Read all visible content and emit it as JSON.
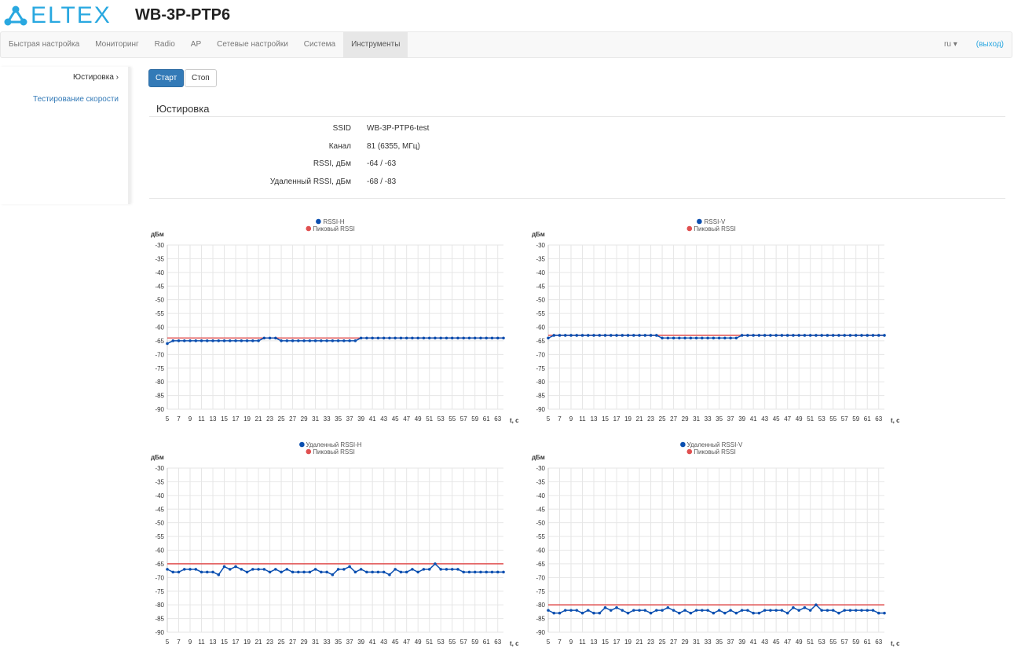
{
  "header": {
    "logo": "ELTEX",
    "device_title": "WB-3P-PTP6"
  },
  "nav": {
    "items": [
      "Быстрая настройка",
      "Мониторинг",
      "Radio",
      "AP",
      "Сетевые настройки",
      "Система",
      "Инструменты"
    ],
    "active": 6,
    "lang": "ru",
    "logout": "(выход)"
  },
  "sidebar": {
    "items": [
      {
        "label": "Юстировка ›"
      },
      {
        "label": "Тестирование скорости"
      }
    ]
  },
  "buttons": {
    "start": "Старт",
    "stop": "Стоп"
  },
  "section": {
    "title": "Юстировка",
    "rows": [
      {
        "k": "SSID",
        "v": "WB-3P-PTP6-test"
      },
      {
        "k": "Канал",
        "v": "81 (6355, МГц)"
      },
      {
        "k": "RSSI, дБм",
        "v": "-64 / -63"
      },
      {
        "k": "Удаленный RSSI, дБм",
        "v": "-68 / -83"
      }
    ]
  },
  "colors": {
    "series": "#0b4fb0",
    "peak": "#e05050",
    "accent": "#337ab7"
  },
  "chart_data": [
    {
      "type": "line",
      "ylabel": "дБм",
      "xlabel": "t, c",
      "ylim": [
        -90,
        -30
      ],
      "xlim": [
        5,
        64
      ],
      "legend": [
        "RSSI-H",
        "Пиковый RSSI"
      ],
      "peak": -64,
      "values": [
        -66,
        -65,
        -65,
        -65,
        -65,
        -65,
        -65,
        -65,
        -65,
        -65,
        -65,
        -65,
        -65,
        -65,
        -65,
        -65,
        -65,
        -64,
        -64,
        -64,
        -65,
        -65,
        -65,
        -65,
        -65,
        -65,
        -65,
        -65,
        -65,
        -65,
        -65,
        -65,
        -65,
        -65,
        -64,
        -64,
        -64,
        -64,
        -64,
        -64,
        -64,
        -64,
        -64,
        -64,
        -64,
        -64,
        -64,
        -64,
        -64,
        -64,
        -64,
        -64,
        -64,
        -64,
        -64,
        -64,
        -64,
        -64,
        -64,
        -64
      ]
    },
    {
      "type": "line",
      "ylabel": "дБм",
      "xlabel": "t, c",
      "ylim": [
        -90,
        -30
      ],
      "xlim": [
        5,
        64
      ],
      "legend": [
        "RSSI-V",
        "Пиковый RSSI"
      ],
      "peak": -63,
      "values": [
        -64,
        -63,
        -63,
        -63,
        -63,
        -63,
        -63,
        -63,
        -63,
        -63,
        -63,
        -63,
        -63,
        -63,
        -63,
        -63,
        -63,
        -63,
        -63,
        -63,
        -64,
        -64,
        -64,
        -64,
        -64,
        -64,
        -64,
        -64,
        -64,
        -64,
        -64,
        -64,
        -64,
        -64,
        -63,
        -63,
        -63,
        -63,
        -63,
        -63,
        -63,
        -63,
        -63,
        -63,
        -63,
        -63,
        -63,
        -63,
        -63,
        -63,
        -63,
        -63,
        -63,
        -63,
        -63,
        -63,
        -63,
        -63,
        -63,
        -63
      ]
    },
    {
      "type": "line",
      "ylabel": "дБм",
      "xlabel": "t, c",
      "ylim": [
        -90,
        -30
      ],
      "xlim": [
        5,
        64
      ],
      "legend": [
        "Удаленный RSSI-H",
        "Пиковый RSSI"
      ],
      "peak": -65,
      "values": [
        -67,
        -68,
        -68,
        -67,
        -67,
        -67,
        -68,
        -68,
        -68,
        -69,
        -66,
        -67,
        -66,
        -67,
        -68,
        -67,
        -67,
        -67,
        -68,
        -67,
        -68,
        -67,
        -68,
        -68,
        -68,
        -68,
        -67,
        -68,
        -68,
        -69,
        -67,
        -67,
        -66,
        -68,
        -67,
        -68,
        -68,
        -68,
        -68,
        -69,
        -67,
        -68,
        -68,
        -67,
        -68,
        -67,
        -67,
        -65,
        -67,
        -67,
        -67,
        -67,
        -68,
        -68,
        -68,
        -68,
        -68,
        -68,
        -68,
        -68
      ]
    },
    {
      "type": "line",
      "ylabel": "дБм",
      "xlabel": "t, c",
      "ylim": [
        -90,
        -30
      ],
      "xlim": [
        5,
        64
      ],
      "legend": [
        "Удаленный RSSI-V",
        "Пиковый RSSI"
      ],
      "peak": -80,
      "values": [
        -82,
        -83,
        -83,
        -82,
        -82,
        -82,
        -83,
        -82,
        -83,
        -83,
        -81,
        -82,
        -81,
        -82,
        -83,
        -82,
        -82,
        -82,
        -83,
        -82,
        -82,
        -81,
        -82,
        -83,
        -82,
        -83,
        -82,
        -82,
        -82,
        -83,
        -82,
        -83,
        -82,
        -83,
        -82,
        -82,
        -83,
        -83,
        -82,
        -82,
        -82,
        -82,
        -83,
        -81,
        -82,
        -81,
        -82,
        -80,
        -82,
        -82,
        -82,
        -83,
        -82,
        -82,
        -82,
        -82,
        -82,
        -82,
        -83,
        -83
      ]
    }
  ]
}
